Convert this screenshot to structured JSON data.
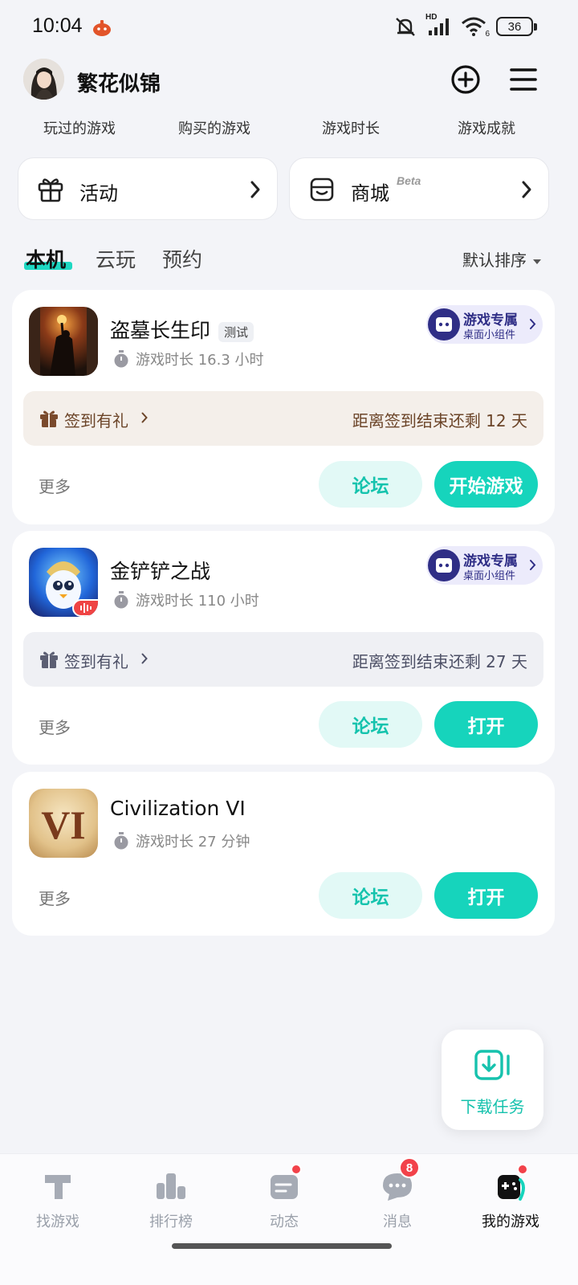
{
  "status_bar": {
    "time": "10:04",
    "battery": "36",
    "signal_label": "HD",
    "wifi_label": "6"
  },
  "header": {
    "username": "繁花似锦",
    "stats": [
      "玩过的游戏",
      "购买的游戏",
      "游戏时长",
      "游戏成就"
    ]
  },
  "entries": {
    "activity": {
      "label": "活动"
    },
    "mall": {
      "label": "商城",
      "badge": "Beta"
    }
  },
  "tabs": {
    "items": [
      "本机",
      "云玩",
      "预约"
    ],
    "active": "本机",
    "sort_label": "默认排序"
  },
  "games": [
    {
      "name": "盗墓长生印",
      "tag": "测试",
      "playtime": "游戏时长 16.3 小时",
      "widget": {
        "title": "游戏专属",
        "subtitle": "桌面小组件"
      },
      "signin": {
        "label": "签到有礼",
        "remaining": "距离签到结束还剩 12 天"
      },
      "more": "更多",
      "forum_label": "论坛",
      "action_label": "开始游戏"
    },
    {
      "name": "金铲铲之战",
      "playtime": "游戏时长 110 小时",
      "widget": {
        "title": "游戏专属",
        "subtitle": "桌面小组件"
      },
      "signin": {
        "label": "签到有礼",
        "remaining": "距离签到结束还剩 27 天"
      },
      "more": "更多",
      "forum_label": "论坛",
      "action_label": "打开"
    },
    {
      "name": "Civilization VI",
      "icon_text": "VI",
      "playtime": "游戏时长 27 分钟",
      "more": "更多",
      "forum_label": "论坛",
      "action_label": "打开"
    }
  ],
  "floating": {
    "download_label": "下载任务"
  },
  "bottom_nav": {
    "items": [
      {
        "label": "找游戏",
        "icon": "find-game-icon"
      },
      {
        "label": "排行榜",
        "icon": "leaderboard-icon"
      },
      {
        "label": "动态",
        "icon": "feed-icon"
      },
      {
        "label": "消息",
        "icon": "message-icon",
        "badge": "8"
      },
      {
        "label": "我的游戏",
        "icon": "my-games-icon"
      }
    ],
    "active": "我的游戏"
  },
  "colors": {
    "accent": "#16d4bc",
    "accent_light": "#e2f9f6",
    "widget_bg": "#ecebfb",
    "widget_fg": "#2f2e86",
    "badge_red": "#f2424a",
    "signin_warm_bg": "#f4efea",
    "signin_cool_bg": "#eff0f4"
  }
}
